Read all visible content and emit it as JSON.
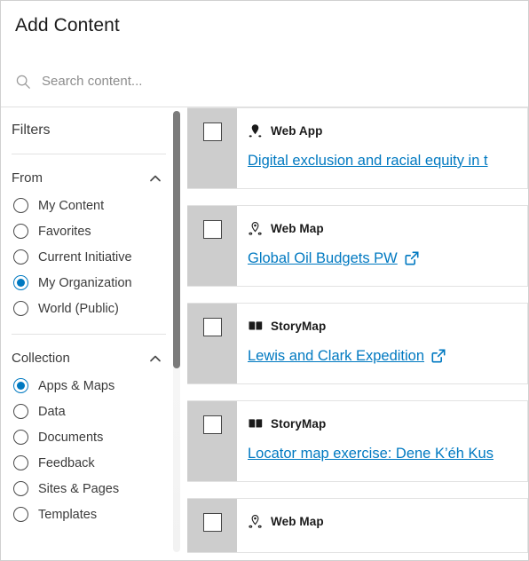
{
  "header": {
    "title": "Add Content"
  },
  "search": {
    "placeholder": "Search content...",
    "value": "",
    "icon": "search-icon"
  },
  "sidebar": {
    "title": "Filters",
    "facets": [
      {
        "title": "From",
        "collapse_icon": "chevron-up-icon",
        "options": [
          {
            "label": "My Content",
            "selected": false
          },
          {
            "label": "Favorites",
            "selected": false
          },
          {
            "label": "Current Initiative",
            "selected": false
          },
          {
            "label": "My Organization",
            "selected": true
          },
          {
            "label": "World (Public)",
            "selected": false
          }
        ]
      },
      {
        "title": "Collection",
        "collapse_icon": "chevron-up-icon",
        "options": [
          {
            "label": "Apps & Maps",
            "selected": true
          },
          {
            "label": "Data",
            "selected": false
          },
          {
            "label": "Documents",
            "selected": false
          },
          {
            "label": "Feedback",
            "selected": false
          },
          {
            "label": "Sites & Pages",
            "selected": false
          },
          {
            "label": "Templates",
            "selected": false
          }
        ]
      }
    ]
  },
  "results": {
    "items": [
      {
        "type": "Web App",
        "type_icon": "map-pin-filled-icon",
        "title": "Digital exclusion and racial equity in t",
        "external_link": false,
        "checked": false
      },
      {
        "type": "Web Map",
        "type_icon": "map-pin-outline-icon",
        "title": "Global Oil Budgets PW",
        "external_link": true,
        "checked": false
      },
      {
        "type": "StoryMap",
        "type_icon": "open-book-icon",
        "title": "Lewis and Clark Expedition",
        "external_link": true,
        "checked": false
      },
      {
        "type": "StoryMap",
        "type_icon": "open-book-icon",
        "title": "Locator map exercise: Dene K’éh Kus",
        "external_link": false,
        "checked": false
      },
      {
        "type": "Web Map",
        "type_icon": "map-pin-outline-icon",
        "title": "",
        "external_link": false,
        "checked": false
      }
    ]
  },
  "colors": {
    "accent": "#0079c1",
    "thumb_bg": "#cdcdcd",
    "text": "#1a1a1a",
    "scrollbar_thumb": "#7b7b7b"
  }
}
